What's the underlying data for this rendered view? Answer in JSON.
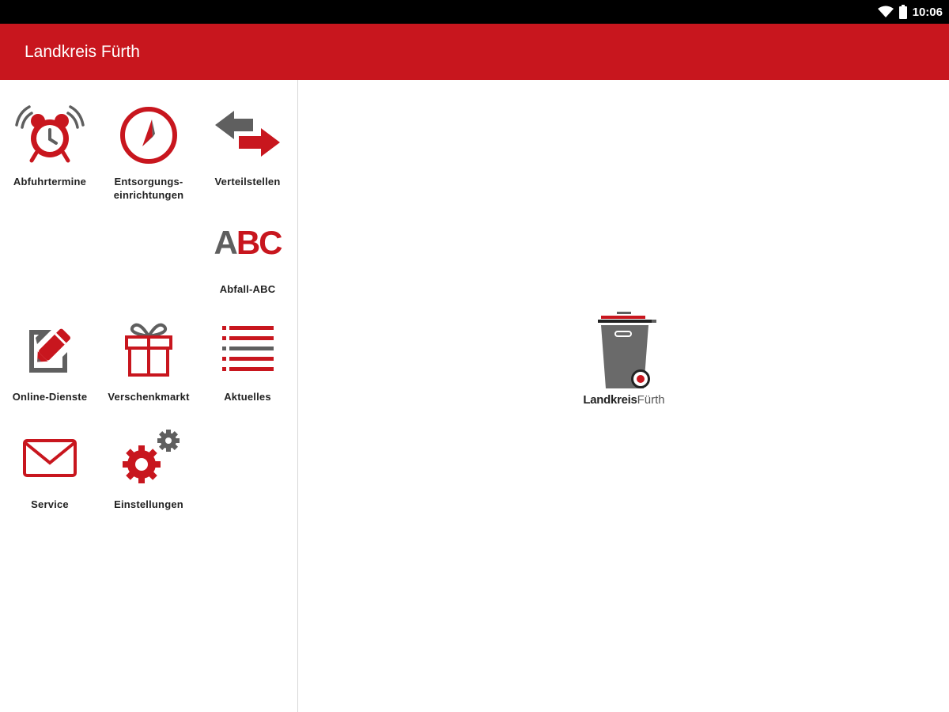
{
  "status_bar": {
    "time": "10:06",
    "icons": [
      "wifi-icon",
      "battery-icon"
    ]
  },
  "app_bar": {
    "title": "Landkreis Fürth"
  },
  "menu": {
    "items": [
      {
        "label_1": "Abfuhrtermine",
        "label_2": "",
        "icon": "alarm-clock-icon"
      },
      {
        "label_1": "Entsorgungs-",
        "label_2": "einrichtungen",
        "icon": "compass-icon"
      },
      {
        "label_1": "Verteilstellen",
        "label_2": "",
        "icon": "swap-arrows-icon"
      },
      {
        "label_1": "Abfall-ABC",
        "label_2": "",
        "icon": "abc-icon",
        "icon_text_a": "A",
        "icon_text_bc": "BC"
      },
      {
        "label_1": "Online-Dienste",
        "label_2": "",
        "icon": "edit-document-icon"
      },
      {
        "label_1": "Verschenkmarkt",
        "label_2": "",
        "icon": "gift-icon"
      },
      {
        "label_1": "Aktuelles",
        "label_2": "",
        "icon": "list-icon"
      },
      {
        "label_1": "Service",
        "label_2": "",
        "icon": "mail-icon"
      },
      {
        "label_1": "Einstellungen",
        "label_2": "",
        "icon": "settings-gears-icon"
      }
    ]
  },
  "logo": {
    "text_bold": "Landkreis",
    "text_light": "Fürth",
    "icon": "waste-bin-logo"
  },
  "colors": {
    "brand_red": "#c8161e",
    "icon_gray": "#5f5f5f",
    "status_bar": "#000000"
  }
}
